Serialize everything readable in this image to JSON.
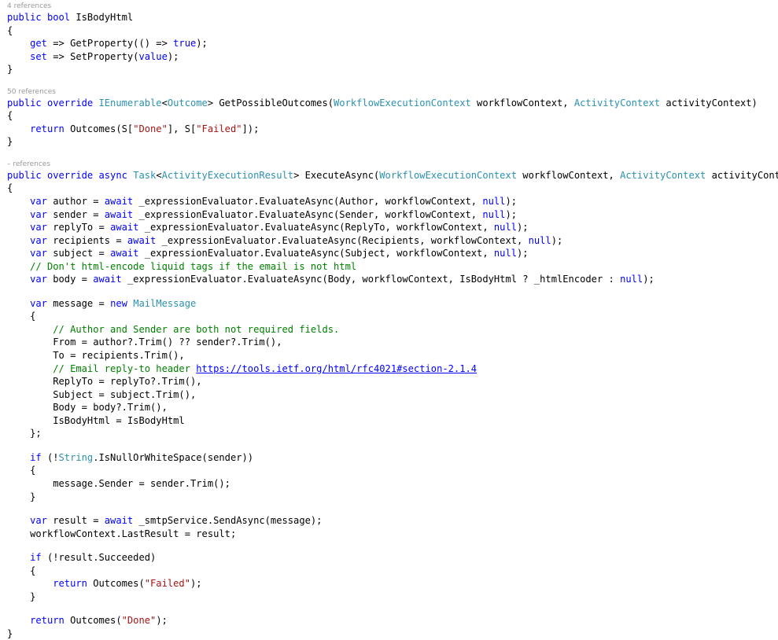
{
  "colors": {
    "background": "#ffffff",
    "keyword": "#0000ff",
    "type": "#2b91af",
    "string": "#a31515",
    "comment": "#008000",
    "link": "#0000ff",
    "codelens": "#999999",
    "text": "#000000"
  },
  "lines": [
    {
      "kind": "codelens",
      "text": "4 references"
    },
    {
      "kind": "code",
      "tokens": [
        {
          "t": "public",
          "c": "kw"
        },
        {
          "t": " "
        },
        {
          "t": "bool",
          "c": "kw"
        },
        {
          "t": " IsBodyHtml"
        }
      ]
    },
    {
      "kind": "code",
      "tokens": [
        {
          "t": "{"
        }
      ]
    },
    {
      "kind": "code",
      "tokens": [
        {
          "t": "    "
        },
        {
          "t": "get",
          "c": "kw"
        },
        {
          "t": " => GetProperty(() => "
        },
        {
          "t": "true",
          "c": "kw"
        },
        {
          "t": ");"
        }
      ]
    },
    {
      "kind": "code",
      "tokens": [
        {
          "t": "    "
        },
        {
          "t": "set",
          "c": "kw"
        },
        {
          "t": " => SetProperty("
        },
        {
          "t": "value",
          "c": "kw"
        },
        {
          "t": ");"
        }
      ]
    },
    {
      "kind": "code",
      "tokens": [
        {
          "t": "}"
        }
      ]
    },
    {
      "kind": "gap"
    },
    {
      "kind": "codelens",
      "text": "50 references"
    },
    {
      "kind": "code",
      "tokens": [
        {
          "t": "public",
          "c": "kw"
        },
        {
          "t": " "
        },
        {
          "t": "override",
          "c": "kw"
        },
        {
          "t": " "
        },
        {
          "t": "IEnumerable",
          "c": "ty"
        },
        {
          "t": "<"
        },
        {
          "t": "Outcome",
          "c": "ty"
        },
        {
          "t": "> GetPossibleOutcomes("
        },
        {
          "t": "WorkflowExecutionContext",
          "c": "ty"
        },
        {
          "t": " workflowContext, "
        },
        {
          "t": "ActivityContext",
          "c": "ty"
        },
        {
          "t": " activityContext)"
        }
      ]
    },
    {
      "kind": "code",
      "tokens": [
        {
          "t": "{"
        }
      ]
    },
    {
      "kind": "code",
      "tokens": [
        {
          "t": "    "
        },
        {
          "t": "return",
          "c": "kw"
        },
        {
          "t": " Outcomes(S["
        },
        {
          "t": "\"Done\"",
          "c": "str"
        },
        {
          "t": "], S["
        },
        {
          "t": "\"Failed\"",
          "c": "str"
        },
        {
          "t": "]);"
        }
      ]
    },
    {
      "kind": "code",
      "tokens": [
        {
          "t": "}"
        }
      ]
    },
    {
      "kind": "gap"
    },
    {
      "kind": "codelens",
      "text": "– references"
    },
    {
      "kind": "code",
      "tokens": [
        {
          "t": "public",
          "c": "kw"
        },
        {
          "t": " "
        },
        {
          "t": "override",
          "c": "kw"
        },
        {
          "t": " "
        },
        {
          "t": "async",
          "c": "kw"
        },
        {
          "t": " "
        },
        {
          "t": "Task",
          "c": "ty"
        },
        {
          "t": "<"
        },
        {
          "t": "ActivityExecutionResult",
          "c": "ty"
        },
        {
          "t": "> ExecuteAsync("
        },
        {
          "t": "WorkflowExecutionContext",
          "c": "ty"
        },
        {
          "t": " workflowContext, "
        },
        {
          "t": "ActivityContext",
          "c": "ty"
        },
        {
          "t": " activityContext)"
        }
      ]
    },
    {
      "kind": "code",
      "tokens": [
        {
          "t": "{"
        }
      ]
    },
    {
      "kind": "code",
      "tokens": [
        {
          "t": "    "
        },
        {
          "t": "var",
          "c": "kw"
        },
        {
          "t": " author = "
        },
        {
          "t": "await",
          "c": "kw"
        },
        {
          "t": " _expressionEvaluator.EvaluateAsync(Author, workflowContext, "
        },
        {
          "t": "null",
          "c": "kw"
        },
        {
          "t": ");"
        }
      ]
    },
    {
      "kind": "code",
      "tokens": [
        {
          "t": "    "
        },
        {
          "t": "var",
          "c": "kw"
        },
        {
          "t": " sender = "
        },
        {
          "t": "await",
          "c": "kw"
        },
        {
          "t": " _expressionEvaluator.EvaluateAsync(Sender, workflowContext, "
        },
        {
          "t": "null",
          "c": "kw"
        },
        {
          "t": ");"
        }
      ]
    },
    {
      "kind": "code",
      "tokens": [
        {
          "t": "    "
        },
        {
          "t": "var",
          "c": "kw"
        },
        {
          "t": " replyTo = "
        },
        {
          "t": "await",
          "c": "kw"
        },
        {
          "t": " _expressionEvaluator.EvaluateAsync(ReplyTo, workflowContext, "
        },
        {
          "t": "null",
          "c": "kw"
        },
        {
          "t": ");"
        }
      ]
    },
    {
      "kind": "code",
      "tokens": [
        {
          "t": "    "
        },
        {
          "t": "var",
          "c": "kw"
        },
        {
          "t": " recipients = "
        },
        {
          "t": "await",
          "c": "kw"
        },
        {
          "t": " _expressionEvaluator.EvaluateAsync(Recipients, workflowContext, "
        },
        {
          "t": "null",
          "c": "kw"
        },
        {
          "t": ");"
        }
      ]
    },
    {
      "kind": "code",
      "tokens": [
        {
          "t": "    "
        },
        {
          "t": "var",
          "c": "kw"
        },
        {
          "t": " subject = "
        },
        {
          "t": "await",
          "c": "kw"
        },
        {
          "t": " _expressionEvaluator.EvaluateAsync(Subject, workflowContext, "
        },
        {
          "t": "null",
          "c": "kw"
        },
        {
          "t": ");"
        }
      ]
    },
    {
      "kind": "code",
      "tokens": [
        {
          "t": "    "
        },
        {
          "t": "// Don't html-encode liquid tags if the email is not html",
          "c": "cm"
        }
      ]
    },
    {
      "kind": "code",
      "tokens": [
        {
          "t": "    "
        },
        {
          "t": "var",
          "c": "kw"
        },
        {
          "t": " body = "
        },
        {
          "t": "await",
          "c": "kw"
        },
        {
          "t": " _expressionEvaluator.EvaluateAsync(Body, workflowContext, IsBodyHtml ? _htmlEncoder : "
        },
        {
          "t": "null",
          "c": "kw"
        },
        {
          "t": ");"
        }
      ]
    },
    {
      "kind": "blank"
    },
    {
      "kind": "code",
      "tokens": [
        {
          "t": "    "
        },
        {
          "t": "var",
          "c": "kw"
        },
        {
          "t": " message = "
        },
        {
          "t": "new",
          "c": "kw"
        },
        {
          "t": " "
        },
        {
          "t": "MailMessage",
          "c": "ty"
        }
      ]
    },
    {
      "kind": "code",
      "tokens": [
        {
          "t": "    {"
        }
      ]
    },
    {
      "kind": "code",
      "tokens": [
        {
          "t": "        "
        },
        {
          "t": "// Author and Sender are both not required fields.",
          "c": "cm"
        }
      ]
    },
    {
      "kind": "code",
      "tokens": [
        {
          "t": "        From = author?.Trim() ?? sender?.Trim(),"
        }
      ]
    },
    {
      "kind": "code",
      "tokens": [
        {
          "t": "        To = recipients.Trim(),"
        }
      ]
    },
    {
      "kind": "code",
      "tokens": [
        {
          "t": "        "
        },
        {
          "t": "// Email reply-to header ",
          "c": "cm"
        },
        {
          "t": "https://tools.ietf.org/html/rfc4021#section-2.1.4",
          "c": "lnk"
        }
      ]
    },
    {
      "kind": "code",
      "tokens": [
        {
          "t": "        ReplyTo = replyTo?.Trim(),"
        }
      ]
    },
    {
      "kind": "code",
      "tokens": [
        {
          "t": "        Subject = subject.Trim(),"
        }
      ]
    },
    {
      "kind": "code",
      "tokens": [
        {
          "t": "        Body = body?.Trim(),"
        }
      ]
    },
    {
      "kind": "code",
      "tokens": [
        {
          "t": "        IsBodyHtml = IsBodyHtml"
        }
      ]
    },
    {
      "kind": "code",
      "tokens": [
        {
          "t": "    };"
        }
      ]
    },
    {
      "kind": "blank"
    },
    {
      "kind": "code",
      "tokens": [
        {
          "t": "    "
        },
        {
          "t": "if",
          "c": "kw"
        },
        {
          "t": " (!"
        },
        {
          "t": "String",
          "c": "ty"
        },
        {
          "t": ".IsNullOrWhiteSpace(sender))"
        }
      ]
    },
    {
      "kind": "code",
      "tokens": [
        {
          "t": "    {"
        }
      ]
    },
    {
      "kind": "code",
      "tokens": [
        {
          "t": "        message.Sender = sender.Trim();"
        }
      ]
    },
    {
      "kind": "code",
      "tokens": [
        {
          "t": "    }"
        }
      ]
    },
    {
      "kind": "blank"
    },
    {
      "kind": "code",
      "tokens": [
        {
          "t": "    "
        },
        {
          "t": "var",
          "c": "kw"
        },
        {
          "t": " result = "
        },
        {
          "t": "await",
          "c": "kw"
        },
        {
          "t": " _smtpService.SendAsync(message);"
        }
      ]
    },
    {
      "kind": "code",
      "tokens": [
        {
          "t": "    workflowContext.LastResult = result;"
        }
      ]
    },
    {
      "kind": "blank"
    },
    {
      "kind": "code",
      "tokens": [
        {
          "t": "    "
        },
        {
          "t": "if",
          "c": "kw"
        },
        {
          "t": " (!result.Succeeded)"
        }
      ]
    },
    {
      "kind": "code",
      "tokens": [
        {
          "t": "    {"
        }
      ]
    },
    {
      "kind": "code",
      "tokens": [
        {
          "t": "        "
        },
        {
          "t": "return",
          "c": "kw"
        },
        {
          "t": " Outcomes("
        },
        {
          "t": "\"Failed\"",
          "c": "str"
        },
        {
          "t": ");"
        }
      ]
    },
    {
      "kind": "code",
      "tokens": [
        {
          "t": "    }"
        }
      ]
    },
    {
      "kind": "blank"
    },
    {
      "kind": "code",
      "tokens": [
        {
          "t": "    "
        },
        {
          "t": "return",
          "c": "kw"
        },
        {
          "t": " Outcomes("
        },
        {
          "t": "\"Done\"",
          "c": "str"
        },
        {
          "t": ");"
        }
      ]
    },
    {
      "kind": "code",
      "tokens": [
        {
          "t": "}"
        }
      ]
    }
  ]
}
